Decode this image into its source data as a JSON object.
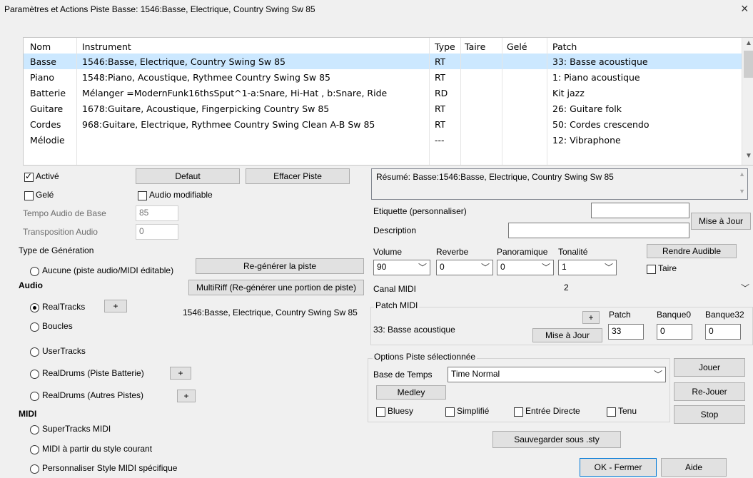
{
  "window": {
    "title": "Paramètres et Actions Piste   Basse: 1546:Basse, Electrique, Country Swing Sw 85",
    "close_label": "×"
  },
  "table": {
    "columns": [
      "Nom",
      "Instrument",
      "Type",
      "Taire",
      "Gelé",
      "Patch"
    ],
    "rows": [
      {
        "name": "Basse",
        "instrument": "1546:Basse, Electrique, Country Swing Sw 85",
        "type": "RT",
        "taire": "",
        "gele": "",
        "patch": "33: Basse acoustique"
      },
      {
        "name": "Piano",
        "instrument": "1548:Piano, Acoustique, Rythmee Country Swing Sw 85",
        "type": "RT",
        "taire": "",
        "gele": "",
        "patch": "1: Piano acoustique"
      },
      {
        "name": "Batterie",
        "instrument": "Mélanger =ModernFunk16thsSput^1-a:Snare, Hi-Hat , b:Snare, Ride",
        "type": "RD",
        "taire": "",
        "gele": "",
        "patch": "Kit jazz"
      },
      {
        "name": "Guitare",
        "instrument": "1678:Guitare, Acoustique, Fingerpicking Country Sw 85",
        "type": "RT",
        "taire": "",
        "gele": "",
        "patch": "26: Guitare folk"
      },
      {
        "name": "Cordes",
        "instrument": "968:Guitare, Electrique, Rythmee Country Swing Clean A-B Sw 85",
        "type": "RT",
        "taire": "",
        "gele": "",
        "patch": "50: Cordes crescendo"
      },
      {
        "name": "Mélodie",
        "instrument": "",
        "type": "---",
        "taire": "",
        "gele": "",
        "patch": "12: Vibraphone"
      }
    ],
    "selected_row": 0
  },
  "left": {
    "active_label": "Activé",
    "active_checked": true,
    "frozen_label": "Gelé",
    "frozen_checked": false,
    "default_button": "Defaut",
    "clear_button": "Effacer Piste",
    "audio_mod_label": "Audio modifiable",
    "audio_mod_checked": false,
    "tempo_label": "Tempo Audio de Base",
    "tempo_value": "85",
    "transpose_label": "Transposition Audio",
    "transpose_value": "0",
    "gen_type_label": "Type de Génération",
    "none_label": "Aucune (piste audio/MIDI éditable)",
    "regen_button": "Re-générer la piste",
    "audio_heading": "Audio",
    "multiriff_button": "MultiRiff (Re-générer une portion de piste)",
    "realtracks_label": "RealTracks",
    "realtracks_selected": true,
    "plus_label": "+",
    "realtracks_value": "1546:Basse, Electrique, Country Swing Sw 85",
    "loops_label": "Boucles",
    "usertracks_label": "UserTracks",
    "realdrums_label": "RealDrums (Piste Batterie)",
    "realdrums_other_label": "RealDrums (Autres Pistes)",
    "midi_heading": "MIDI",
    "supertracks_label": "SuperTracks MIDI",
    "midi_style_label": "MIDI à partir du style courant",
    "custom_style_label": "Personnaliser Style MIDI spécifique"
  },
  "right": {
    "summary": "Résumé: Basse:1546:Basse, Electrique, Country Swing Sw 85",
    "label_label": "Etiquette (personnaliser)",
    "label_value": "",
    "description_label": "Description",
    "description_value": "",
    "update_button": "Mise à Jour",
    "volume_label": "Volume",
    "volume_value": "90",
    "reverb_label": "Reverbe",
    "reverb_value": "0",
    "pan_label": "Panoramique",
    "pan_value": "0",
    "tone_label": "Tonalité",
    "tone_value": "1",
    "audible_button": "Rendre Audible",
    "mute_label": "Taire",
    "mute_checked": false,
    "midi_channel_label": "Canal MIDI",
    "midi_channel_value": "2",
    "patch_midi_label": "Patch MIDI",
    "patch_plus": "+",
    "patch_col_label": "Patch",
    "bank0_label": "Banque0",
    "bank32_label": "Banque32",
    "patch_name": "33: Basse acoustique",
    "patch_update_button": "Mise à Jour",
    "patch_value": "33",
    "bank0_value": "0",
    "bank32_value": "0",
    "options_label": "Options Piste sélectionnée",
    "time_base_label": "Base de Temps",
    "time_base_value": "Time Normal",
    "medley_button": "Medley",
    "bluesy_label": "Bluesy",
    "simplified_label": "Simplifié",
    "direct_input_label": "Entrée Directe",
    "held_label": "Tenu",
    "play_button": "Jouer",
    "replay_button": "Re-Jouer",
    "stop_button": "Stop",
    "save_sty_button": "Sauvegarder sous .sty",
    "ok_button": "OK - Fermer",
    "help_button": "Aide"
  }
}
